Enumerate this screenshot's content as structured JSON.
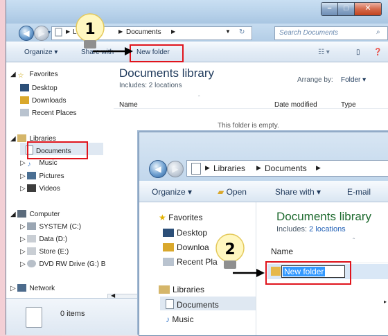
{
  "main_window": {
    "address": {
      "root": "Li",
      "current": "Documents"
    },
    "search_placeholder": "Search Documents",
    "toolbar": {
      "organize": "Organize",
      "share_with": "Share with",
      "new_folder": "New folder"
    },
    "nav": {
      "favorites": "Favorites",
      "desktop": "Desktop",
      "downloads": "Downloads",
      "recent_places": "Recent Places",
      "libraries": "Libraries",
      "documents": "Documents",
      "music": "Music",
      "pictures": "Pictures",
      "videos": "Videos",
      "computer": "Computer",
      "system_c": "SYSTEM (C:)",
      "data_d": "Data (D:)",
      "store_e": "Store (E:)",
      "dvd": "DVD RW Drive (G:) B",
      "network": "Network"
    },
    "library_title": "Documents library",
    "includes": "Includes: 2 locations",
    "arrange_label": "Arrange by:",
    "arrange_value": "Folder",
    "columns": {
      "name": "Name",
      "date_modified": "Date modified",
      "type": "Type"
    },
    "empty_message": "This folder is empty.",
    "status_items": "0 items"
  },
  "inset_window": {
    "address": {
      "libraries": "Libraries",
      "documents": "Documents"
    },
    "toolbar": {
      "organize": "Organize",
      "open": "Open",
      "share_with": "Share with",
      "email": "E-mail"
    },
    "nav": {
      "favorites": "Favorites",
      "desktop": "Desktop",
      "downloads": "Downloa",
      "recent_places": "Recent Pla",
      "libraries": "Libraries",
      "documents": "Documents",
      "music": "Music"
    },
    "library_title": "Documents library",
    "includes_label": "Includes:",
    "includes_link": "2 locations",
    "column_name": "Name",
    "new_folder_value": "New folder"
  },
  "callouts": {
    "step1": "1",
    "step2": "2"
  },
  "colors": {
    "highlight_red": "#e0141c",
    "link_blue": "#1f5fb5",
    "title_green": "#1d6a2e"
  }
}
